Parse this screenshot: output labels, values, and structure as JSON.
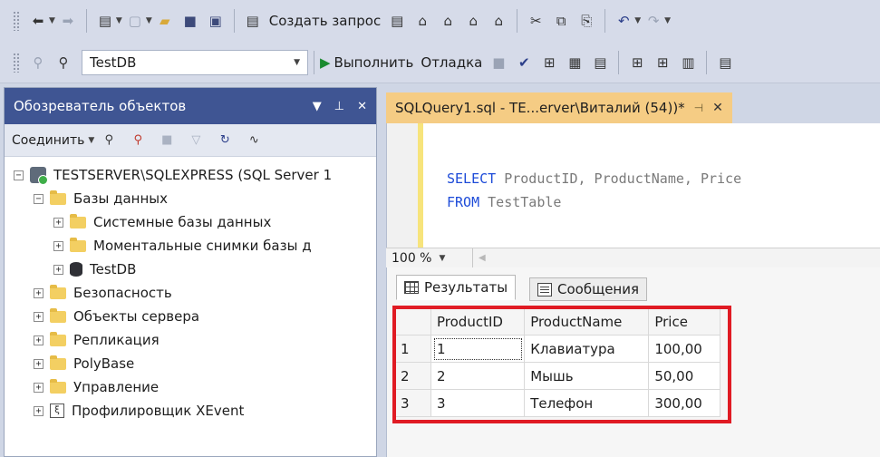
{
  "toolbar1": {
    "new_query_label": "Создать запрос",
    "query_icons": [
      "mdx-icon",
      "dmx-icon",
      "xmla-icon",
      "dax-icon"
    ]
  },
  "toolbar2": {
    "database": "TestDB",
    "execute_label": "Выполнить",
    "debug_label": "Отладка"
  },
  "object_explorer": {
    "title": "Обозреватель объектов",
    "connect_label": "Соединить",
    "tree": [
      {
        "label": "TESTSERVER\\SQLEXPRESS (SQL Server 1",
        "level": 0,
        "expanded": true,
        "icon": "server-icon"
      },
      {
        "label": "Базы данных",
        "level": 1,
        "expanded": true,
        "icon": "folder-icon"
      },
      {
        "label": "Системные базы данных",
        "level": 2,
        "expanded": false,
        "icon": "folder-icon"
      },
      {
        "label": "Моментальные снимки базы д",
        "level": 2,
        "expanded": false,
        "icon": "folder-icon"
      },
      {
        "label": "TestDB",
        "level": 2,
        "expanded": false,
        "icon": "database-icon"
      },
      {
        "label": "Безопасность",
        "level": 1,
        "expanded": false,
        "icon": "folder-icon"
      },
      {
        "label": "Объекты сервера",
        "level": 1,
        "expanded": false,
        "icon": "folder-icon"
      },
      {
        "label": "Репликация",
        "level": 1,
        "expanded": false,
        "icon": "folder-icon"
      },
      {
        "label": "PolyBase",
        "level": 1,
        "expanded": false,
        "icon": "folder-icon"
      },
      {
        "label": "Управление",
        "level": 1,
        "expanded": false,
        "icon": "folder-icon"
      },
      {
        "label": "Профилировщик XEvent",
        "level": 1,
        "expanded": false,
        "icon": "xevent-icon"
      }
    ]
  },
  "editor": {
    "tab_title": "SQLQuery1.sql - TE...erver\\Виталий (54))*",
    "line1_kw1": "SELECT",
    "line1_rest": " ProductID, ProductName, Price",
    "line2_kw": "FROM",
    "line2_rest": " TestTable",
    "zoom": "100 %"
  },
  "results": {
    "tab_results": "Результаты",
    "tab_messages": "Сообщения",
    "columns": [
      "ProductID",
      "ProductName",
      "Price"
    ],
    "rows": [
      {
        "n": "1",
        "ProductID": "1",
        "ProductName": "Клавиатура",
        "Price": "100,00"
      },
      {
        "n": "2",
        "ProductID": "2",
        "ProductName": "Мышь",
        "Price": "50,00"
      },
      {
        "n": "3",
        "ProductID": "3",
        "ProductName": "Телефон",
        "Price": "300,00"
      }
    ]
  },
  "colors": {
    "title_bar": "#3f5593",
    "active_tab": "#f5cc84",
    "highlight_box": "#e01b24",
    "keyword": "#1d4bd8"
  }
}
